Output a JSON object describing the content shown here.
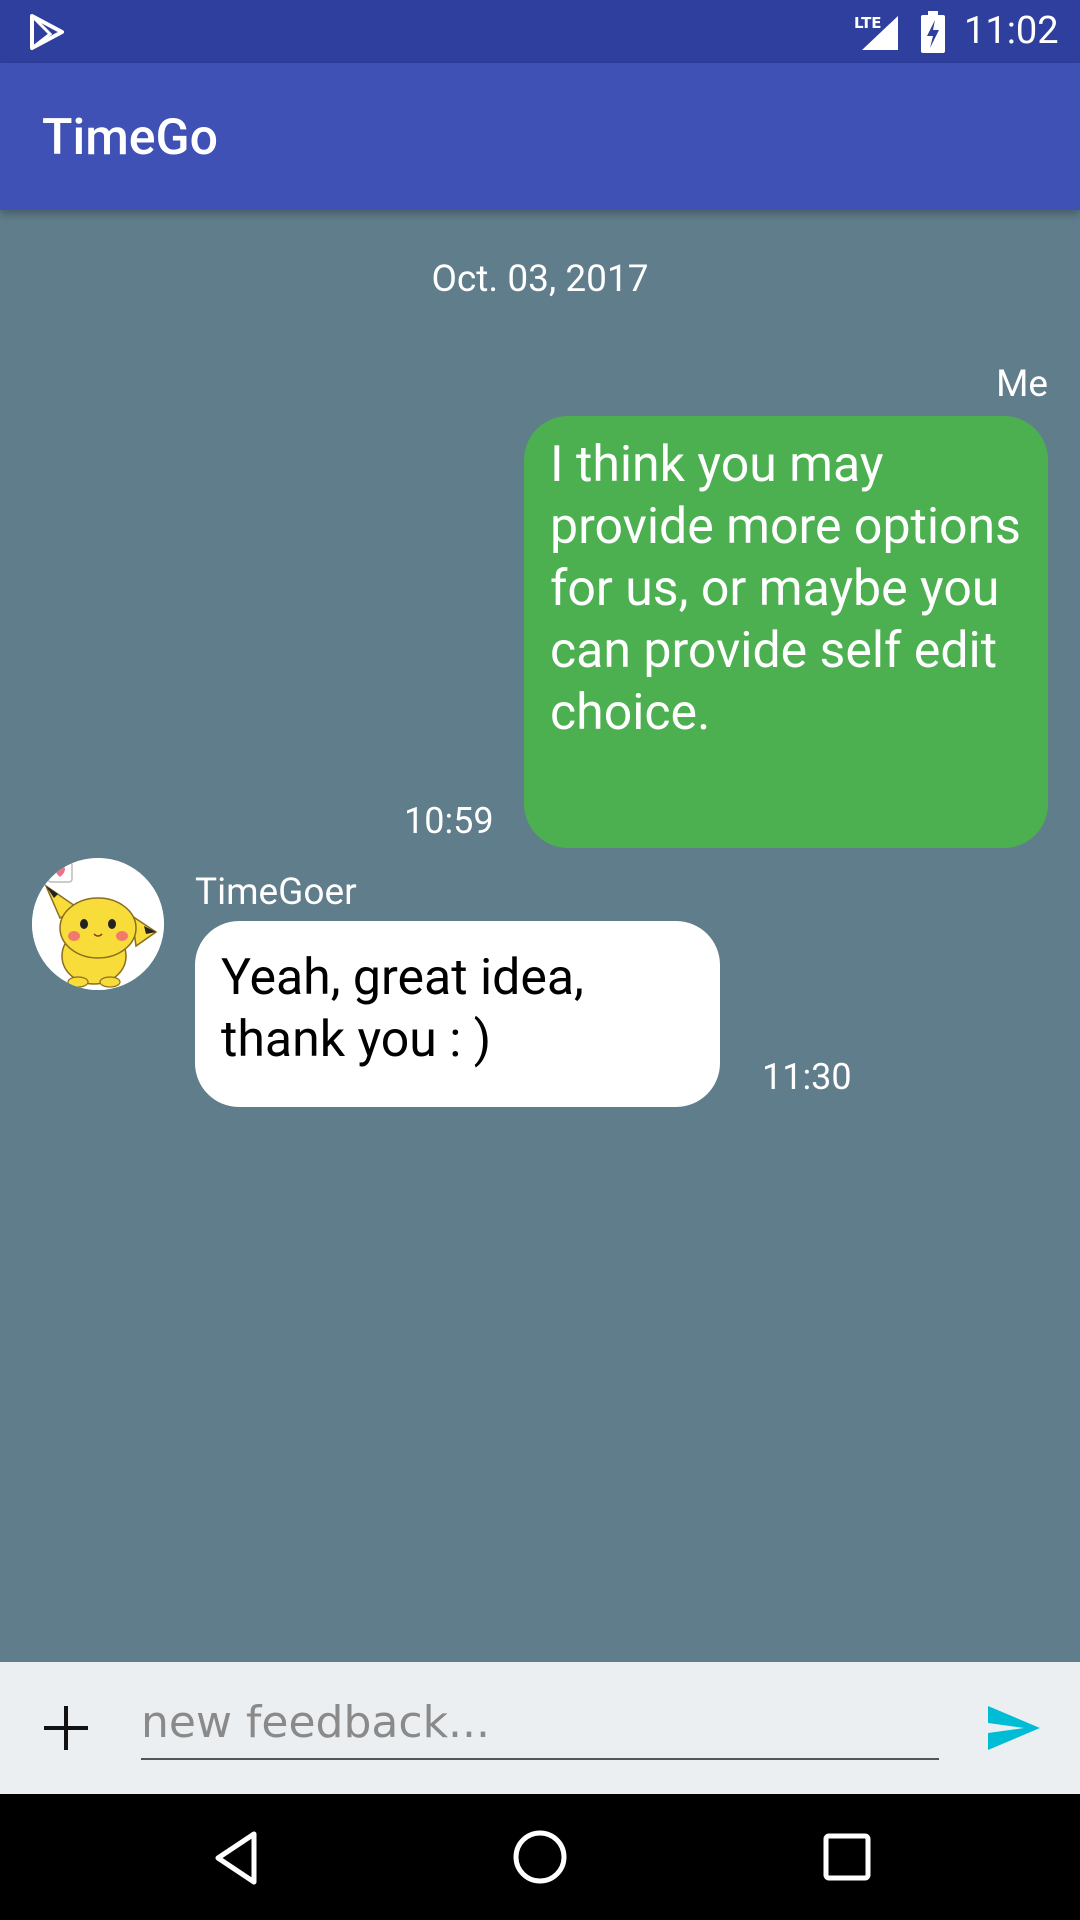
{
  "status_bar": {
    "network_label": "LTE",
    "time": "11:02",
    "icons": [
      "play-store-icon",
      "signal-icon",
      "battery-charging-icon"
    ]
  },
  "app_bar": {
    "title": "TimeGo"
  },
  "chat": {
    "date": "Oct. 03, 2017",
    "messages": [
      {
        "sender": "Me",
        "text": "I think you may provide more options for us, or maybe you can provide self edit choice.",
        "time": "10:59",
        "bubble_color": "#4CAF50"
      },
      {
        "sender": "TimeGoer",
        "text": "Yeah, great idea, thank you : )",
        "time": "11:30",
        "bubble_color": "#FFFFFF",
        "avatar": "pikachu-avatar"
      }
    ]
  },
  "input": {
    "placeholder": "new feedback...",
    "add_icon": "plus-icon",
    "send_icon": "send-icon"
  },
  "nav_bar": {
    "icons": [
      "back-icon",
      "home-icon",
      "recent-apps-icon"
    ]
  },
  "colors": {
    "status_bar": "#2F3F9E",
    "app_bar": "#3F51B5",
    "chat_background": "#607D8B",
    "input_background": "#ECEFF1",
    "send_accent": "#00BCD4"
  }
}
